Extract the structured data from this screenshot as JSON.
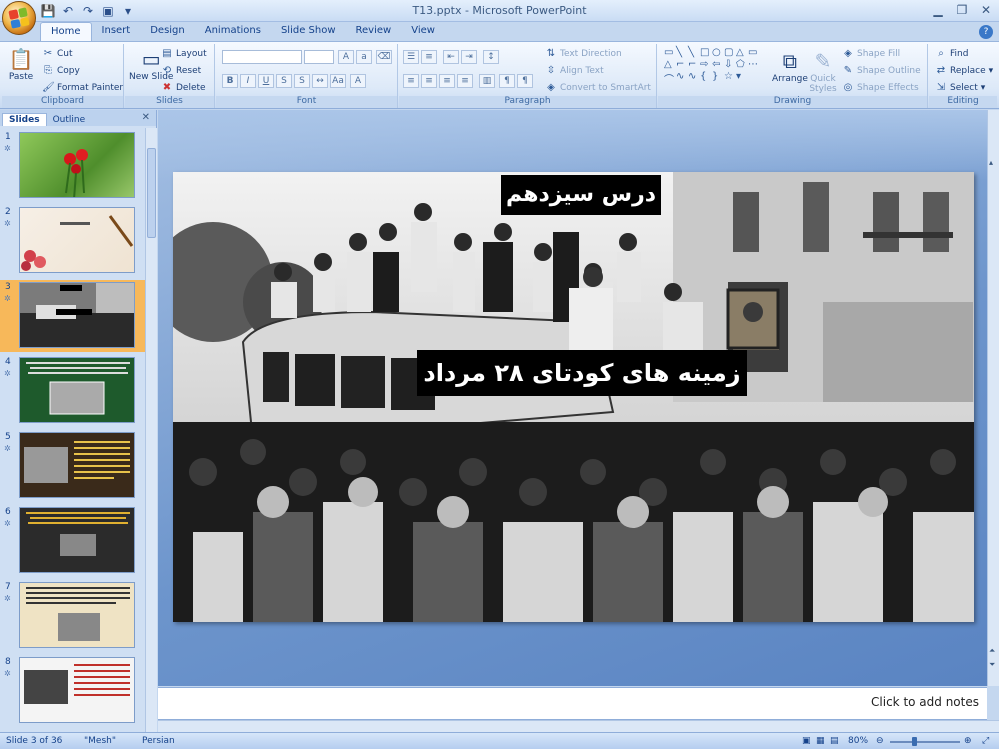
{
  "window": {
    "title": "T13.pptx - Microsoft PowerPoint"
  },
  "tabs": [
    "Home",
    "Insert",
    "Design",
    "Animations",
    "Slide Show",
    "Review",
    "View"
  ],
  "ribbon": {
    "clipboard": {
      "label": "Clipboard",
      "paste": "Paste",
      "cut": "Cut",
      "copy": "Copy",
      "format_painter": "Format Painter"
    },
    "slides": {
      "label": "Slides",
      "new_slide": "New Slide",
      "layout": "Layout",
      "reset": "Reset",
      "delete": "Delete"
    },
    "font": {
      "label": "Font"
    },
    "paragraph": {
      "label": "Paragraph",
      "text_direction": "Text Direction",
      "align_text": "Align Text",
      "convert_smartart": "Convert to SmartArt"
    },
    "drawing": {
      "label": "Drawing",
      "arrange": "Arrange",
      "quick_styles": "Quick Styles",
      "shape_fill": "Shape Fill",
      "shape_outline": "Shape Outline",
      "shape_effects": "Shape Effects"
    },
    "editing": {
      "label": "Editing",
      "find": "Find",
      "replace": "Replace",
      "select": "Select"
    }
  },
  "panel": {
    "tab_slides": "Slides",
    "tab_outline": "Outline",
    "thumbnails": [
      {
        "num": "1"
      },
      {
        "num": "2"
      },
      {
        "num": "3"
      },
      {
        "num": "4"
      },
      {
        "num": "5"
      },
      {
        "num": "6"
      },
      {
        "num": "7"
      },
      {
        "num": "8"
      }
    ],
    "selected": 3
  },
  "slide": {
    "title": "درس سیزدهم",
    "subtitle": "زمینه های کودتای ۲۸ مرداد"
  },
  "notes": {
    "placeholder": "Click to add notes"
  },
  "status": {
    "slide_info": "Slide 3 of 36",
    "theme": "\"Mesh\"",
    "language": "Persian",
    "zoom": "80%"
  },
  "colors": {
    "selected_thumb": "#f7b85a",
    "editor_bg": "#6d95cc"
  }
}
